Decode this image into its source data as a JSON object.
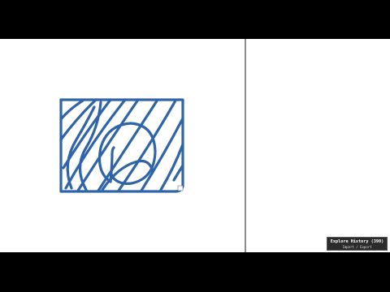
{
  "stroke_color": "#2f64a8",
  "background_color": "#ffffff",
  "history_panel": {
    "title": "Explore History (390)",
    "subtitle": "Import / Export"
  },
  "icons": {
    "resize_handle": "resize-handle-icon"
  }
}
